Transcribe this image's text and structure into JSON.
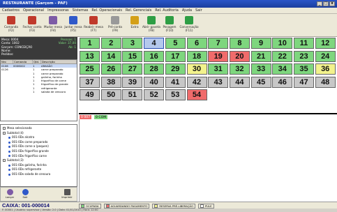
{
  "window": {
    "title": "RESTAURANTE (Garçom - PAF)",
    "btn_min": "_",
    "btn_max": "□",
    "btn_close": "x"
  },
  "menu": [
    "Cadastros",
    "Operacional",
    "Impressoras",
    "Sistemas",
    "Rel. Operacionais",
    "Rel. Gerenciais",
    "Rel. Auditoria",
    "Ajuda",
    "Sair"
  ],
  "toolbar": [
    {
      "label": "Comanda (F2)",
      "icon": "comanda-icon",
      "color": "#c0392b"
    },
    {
      "label": "Fechar conta (F3)",
      "icon": "fechar-conta-icon",
      "color": "#c0392b"
    },
    {
      "label": "Mudar mesa (F4)",
      "icon": "mudar-mesa-icon",
      "color": "#7d5ba6"
    },
    {
      "label": "Juntar mesa (F5)",
      "icon": "juntar-mesa-icon",
      "color": "#2f59c9"
    },
    {
      "label": "Reabrir mesa (F7)",
      "icon": "reabrir-mesa-icon",
      "color": "#c0392b"
    },
    {
      "label": "Pré-conta (F9)",
      "icon": "pre-conta-icon",
      "color": "#999999"
    },
    {
      "label": "Extra",
      "icon": "extra-icon",
      "color": "#d4a017"
    },
    {
      "label": "Abrir gaveta (F8)",
      "icon": "abrir-gaveta-icon",
      "color": "#2e9e44"
    },
    {
      "label": "Pesagem (F10)",
      "icon": "pesagem-icon",
      "color": "#2e9e44"
    },
    {
      "label": "Conversação (F11)",
      "icon": "conversacao-icon",
      "color": "#2e9e44"
    }
  ],
  "info": {
    "mesa_label": "Mesa: 0004",
    "mesa_value": "Pessoas: 1",
    "conta_label": "Conta: 1002",
    "conta_value": "Valor: 37,00",
    "garcom_label": "Garçom: CONCEIÇÃO",
    "garcom_value": "Ab: 1",
    "extra1": "Nome:",
    "extra2": "Pedidos:"
  },
  "items": {
    "headers": [
      "Nro",
      "Comanda",
      "Qtd.",
      "Descrição"
    ],
    "rows": [
      [
        "0106",
        "0006002",
        "1",
        "ARAGÃO"
      ],
      [
        "0126",
        "",
        "1",
        "carne preparado"
      ],
      [
        "",
        "",
        "1",
        "carne preparado"
      ],
      [
        "",
        "",
        "1",
        "galinha, farinha"
      ],
      [
        "",
        "",
        "1",
        "frigorífico de carne"
      ],
      [
        "",
        "",
        "1",
        "frigorífico de grande"
      ],
      [
        "",
        "",
        "1",
        "refrigerante"
      ],
      [
        "",
        "",
        "1",
        "salada de cenoura"
      ]
    ]
  },
  "tree": [
    {
      "text": "Mesa selecionada",
      "level": 0,
      "type": "exp"
    },
    {
      "text": "Subtotal (4)",
      "level": 0,
      "type": "exp"
    },
    {
      "text": "001-0Dx alcatra",
      "level": 1,
      "type": "bullet"
    },
    {
      "text": "001-0Dx carne preparado",
      "level": 1,
      "type": "bullet"
    },
    {
      "text": "001-0Dx carne a (pequen)",
      "level": 1,
      "type": "bullet"
    },
    {
      "text": "001-0Dx frigorífico grande",
      "level": 1,
      "type": "bullet"
    },
    {
      "text": "001-0Dx frigorífico carne",
      "level": 1,
      "type": "bullet"
    },
    {
      "text": "Subtotal (3)",
      "level": 0,
      "type": "exp"
    },
    {
      "text": "001-0Dx galinha, farinha",
      "level": 1,
      "type": "bullet"
    },
    {
      "text": "001-0Dx refrigerante",
      "level": 1,
      "type": "bullet"
    },
    {
      "text": "001-0Dx salada de cenoura",
      "level": 1,
      "type": "bullet"
    }
  ],
  "bottom_buttons": [
    "Lançar",
    "Sair",
    "Imprimir"
  ],
  "tables": [
    {
      "n": "1",
      "s": "free"
    },
    {
      "n": "2",
      "s": "free"
    },
    {
      "n": "3",
      "s": "free"
    },
    {
      "n": "4",
      "s": "selected"
    },
    {
      "n": "5",
      "s": "free"
    },
    {
      "n": "6",
      "s": "free"
    },
    {
      "n": "7",
      "s": "free"
    },
    {
      "n": "8",
      "s": "free"
    },
    {
      "n": "9",
      "s": "free"
    },
    {
      "n": "10",
      "s": "free"
    },
    {
      "n": "11",
      "s": "free"
    },
    {
      "n": "12",
      "s": "free"
    },
    {
      "n": "13",
      "s": "free"
    },
    {
      "n": "14",
      "s": "free"
    },
    {
      "n": "15",
      "s": "free"
    },
    {
      "n": "16",
      "s": "free"
    },
    {
      "n": "17",
      "s": "free"
    },
    {
      "n": "18",
      "s": "free"
    },
    {
      "n": "19",
      "s": "closing"
    },
    {
      "n": "20",
      "s": "closing"
    },
    {
      "n": "21",
      "s": "free"
    },
    {
      "n": "22",
      "s": "free"
    },
    {
      "n": "23",
      "s": "free"
    },
    {
      "n": "24",
      "s": "free"
    },
    {
      "n": "25",
      "s": "free"
    },
    {
      "n": "26",
      "s": "free"
    },
    {
      "n": "27",
      "s": "free"
    },
    {
      "n": "28",
      "s": "free"
    },
    {
      "n": "29",
      "s": "free"
    },
    {
      "n": "30",
      "s": "reserved"
    },
    {
      "n": "31",
      "s": "free"
    },
    {
      "n": "32",
      "s": "free"
    },
    {
      "n": "33",
      "s": "free"
    },
    {
      "n": "34",
      "s": "free"
    },
    {
      "n": "35",
      "s": "free"
    },
    {
      "n": "36",
      "s": "reserved"
    },
    {
      "n": "37",
      "s": "occupied"
    },
    {
      "n": "38",
      "s": "occupied"
    },
    {
      "n": "39",
      "s": "occupied"
    },
    {
      "n": "40",
      "s": "occupied"
    },
    {
      "n": "41",
      "s": "occupied"
    },
    {
      "n": "42",
      "s": "occupied"
    },
    {
      "n": "43",
      "s": "occupied"
    },
    {
      "n": "44",
      "s": "occupied"
    },
    {
      "n": "45",
      "s": "occupied"
    },
    {
      "n": "46",
      "s": "occupied"
    },
    {
      "n": "47",
      "s": "occupied"
    },
    {
      "n": "48",
      "s": "occupied"
    },
    {
      "n": "49",
      "s": "occupied"
    },
    {
      "n": "50",
      "s": "occupied"
    },
    {
      "n": "51",
      "s": "occupied"
    },
    {
      "n": "52",
      "s": "occupied"
    },
    {
      "n": "53",
      "s": "occupied"
    },
    {
      "n": "54",
      "s": "closing"
    }
  ],
  "strip": {
    "tag1": "0 007",
    "tag2": "0 COM"
  },
  "status": {
    "caixa": "CAIXA: 001-000014",
    "legend": [
      {
        "label": "OCUPADA",
        "color": "#7ed67e"
      },
      {
        "label": "AGUARDANDO PAGAMENTO",
        "color": "#f06b6b"
      },
      {
        "label": "RESERVA PRÉ-LIBERAÇÃO",
        "color": "#f2f28c"
      },
      {
        "label": "PULE",
        "color": "#ffffff"
      }
    ]
  },
  "footer": "F: 00001 | Usuário: supervisor | Versão: 2.0 | Data: 01/01/2010 | Hora: 12:00"
}
